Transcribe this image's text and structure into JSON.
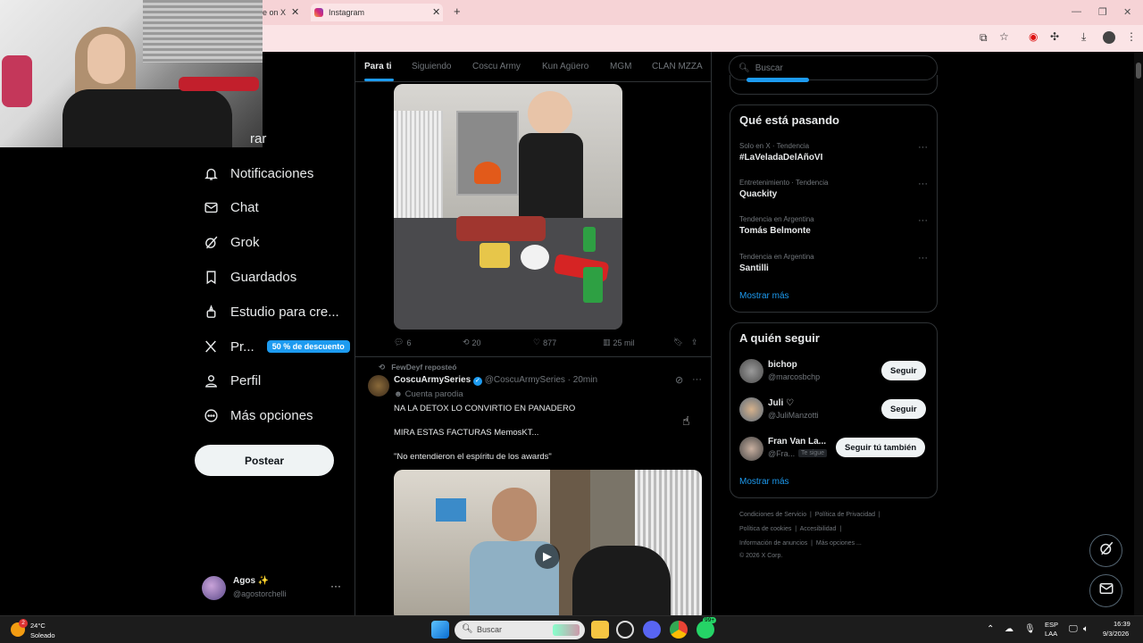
{
  "browser": {
    "tabs": [
      {
        "title": "e on X"
      },
      {
        "title": "Instagram"
      }
    ]
  },
  "sidebar": {
    "partial_item": "rar",
    "items": [
      {
        "label": "Notificaciones",
        "icon": "bell-icon"
      },
      {
        "label": "Chat",
        "icon": "mail-icon"
      },
      {
        "label": "Grok",
        "icon": "grok-icon"
      },
      {
        "label": "Guardados",
        "icon": "bookmark-icon"
      },
      {
        "label": "Estudio para cre...",
        "icon": "creator-studio-icon"
      },
      {
        "label": "Pr...",
        "icon": "x-logo-icon",
        "badge": "50 % de descuento"
      },
      {
        "label": "Perfil",
        "icon": "person-icon"
      },
      {
        "label": "Más opciones",
        "icon": "more-circle-icon"
      }
    ],
    "post_button": "Postear",
    "account": {
      "name": "Agos ✨",
      "handle": "@agostorchelli"
    }
  },
  "timeline": {
    "tabs": [
      "Para ti",
      "Siguiendo",
      "Coscu Army",
      "Kun Agüero",
      "MGM",
      "CLAN MZZA"
    ],
    "post1_actions": {
      "replies": "6",
      "reposts": "20",
      "likes": "877",
      "views": "25 mil"
    },
    "post2": {
      "repost_note": "FewDeyf reposteó",
      "author": "CoscuArmySeries",
      "handle": "@CoscuArmySeries",
      "time": "· 20min",
      "parody_label": "Cuenta parodia",
      "lines": [
        "NA LA DETOX LO CONVIRTIO EN PANADERO",
        "MIRA ESTAS FACTURAS MemosKT...",
        "\"No entendieron el espíritu de los awards\""
      ]
    }
  },
  "search": {
    "placeholder": "Buscar"
  },
  "trends": {
    "title": "Qué está pasando",
    "items": [
      {
        "meta": "Solo en X · Tendencia",
        "name": "#LaVeladaDelAñoVI"
      },
      {
        "meta": "Entretenimiento · Tendencia",
        "name": "Quackity"
      },
      {
        "meta": "Tendencia en Argentina",
        "name": "Tomás Belmonte"
      },
      {
        "meta": "Tendencia en Argentina",
        "name": "Santilli"
      }
    ],
    "more": "Mostrar más"
  },
  "follow": {
    "title": "A quién seguir",
    "items": [
      {
        "name": "bichop",
        "handle": "@marcosbchp",
        "button": "Seguir"
      },
      {
        "name": "Juli ♡",
        "handle": "@JuliManzotti",
        "button": "Seguir"
      },
      {
        "name": "Fran Van La...",
        "handle": "@Fra...",
        "follows_you": "Te sigue",
        "button": "Seguir tú también"
      }
    ],
    "more": "Mostrar más"
  },
  "footer": {
    "row1": [
      "Condiciones de Servicio",
      "Política de Privacidad"
    ],
    "row2": [
      "Política de cookies",
      "Accesibilidad"
    ],
    "row3": [
      "Información de anuncios",
      "Más opciones ..."
    ],
    "copyright": "© 2026 X Corp."
  },
  "taskbar": {
    "weather_temp": "24°C",
    "weather_desc": "Soleado",
    "search_placeholder": "Buscar",
    "lang1": "ESP",
    "lang2": "LAA",
    "time": "16:39",
    "date": "9/3/2026",
    "notif_count": "2",
    "badge_99": "99+"
  },
  "colors": {
    "accent": "#1d9bf0",
    "bg": "#000000",
    "tabbar": "#f6d3d6"
  }
}
